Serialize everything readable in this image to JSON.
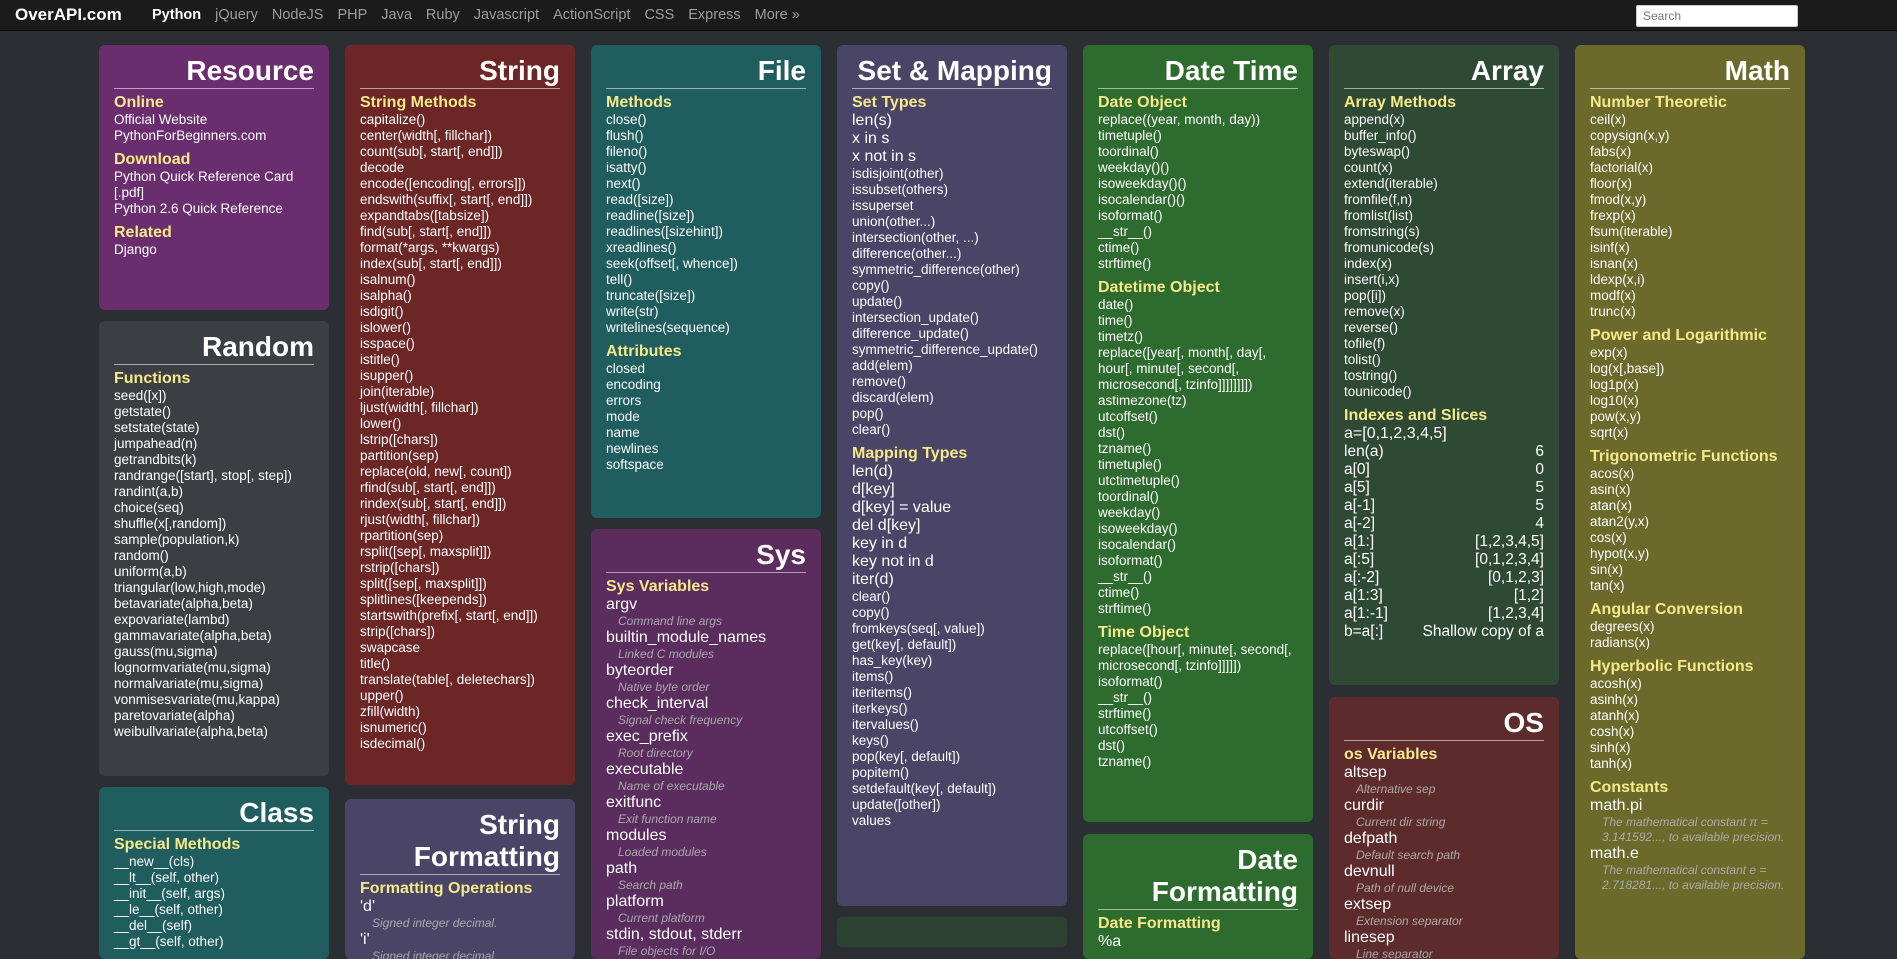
{
  "brand": "OverAPI.com",
  "nav": [
    "Python",
    "jQuery",
    "NodeJS",
    "PHP",
    "Java",
    "Ruby",
    "Javascript",
    "ActionScript",
    "CSS",
    "Express",
    "More »"
  ],
  "search": {
    "placeholder": "Search"
  },
  "cards": {
    "resource": {
      "title": "Resource",
      "sections": [
        {
          "h": "Online",
          "items": [
            "Official Website",
            "PythonForBeginners.com"
          ]
        },
        {
          "h": "Download",
          "items": [
            "Python Quick Reference Card [.pdf]",
            "Python 2.6 Quick Reference"
          ]
        },
        {
          "h": "Related",
          "items": [
            "Django"
          ]
        }
      ]
    },
    "random": {
      "title": "Random",
      "sections": [
        {
          "h": "Functions",
          "items": [
            "seed([x])",
            "getstate()",
            "setstate(state)",
            "jumpahead(n)",
            "getrandbits(k)",
            "randrange([start], stop[, step])",
            "randint(a,b)",
            "choice(seq)",
            "shuffle(x[,random])",
            "sample(population,k)",
            "random()",
            "uniform(a,b)",
            "triangular(low,high,mode)",
            "betavariate(alpha,beta)",
            "expovariate(lambd)",
            "gammavariate(alpha,beta)",
            "gauss(mu,sigma)",
            "lognormvariate(mu,sigma)",
            "normalvariate(mu,sigma)",
            "vonmisesvariate(mu,kappa)",
            "paretovariate(alpha)",
            "weibullvariate(alpha,beta)"
          ]
        }
      ]
    },
    "class": {
      "title": "Class",
      "sections": [
        {
          "h": "Special Methods",
          "items": [
            "__new__(cls)",
            "__lt__(self, other)",
            "__init__(self, args)",
            "__le__(self, other)",
            "__del__(self)",
            "__gt__(self, other)"
          ]
        }
      ]
    },
    "string": {
      "title": "String",
      "sections": [
        {
          "h": "String Methods",
          "items": [
            "capitalize()",
            "center(width[, fillchar])",
            "count(sub[, start[, end]])",
            "decode",
            "encode([encoding[, errors]])",
            "endswith(suffix[, start[, end]])",
            "expandtabs([tabsize])",
            "find(sub[, start[, end]])",
            "format(*args, **kwargs)",
            "index(sub[, start[, end]])",
            "isalnum()",
            "isalpha()",
            "isdigit()",
            "islower()",
            "isspace()",
            "istitle()",
            "isupper()",
            "join(iterable)",
            "ljust(width[, fillchar])",
            "lower()",
            "lstrip([chars])",
            "partition(sep)",
            "replace(old, new[, count])",
            "rfind(sub[, start[, end]])",
            "rindex(sub[, start[, end]])",
            "rjust(width[, fillchar])",
            "rpartition(sep)",
            "rsplit([sep[, maxsplit]])",
            "rstrip([chars])",
            "split([sep[, maxsplit]])",
            "splitlines([keepends])",
            "startswith(prefix[, start[, end]])",
            "strip([chars])",
            "swapcase",
            "title()",
            "translate(table[, deletechars])",
            "upper()",
            "zfill(width)",
            "isnumeric()",
            "isdecimal()"
          ]
        }
      ]
    },
    "stringfmt": {
      "title": "String Formatting",
      "sections": [
        {
          "h": "Formatting Operations",
          "entries": [
            {
              "k": "'d'",
              "d": "Signed integer decimal."
            },
            {
              "k": "'i'",
              "d": "Signed integer decimal."
            }
          ]
        }
      ]
    },
    "file": {
      "title": "File",
      "sections": [
        {
          "h": "Methods",
          "items": [
            "close()",
            "flush()",
            "fileno()",
            "isatty()",
            "next()",
            "read([size])",
            "readline([size])",
            "readlines([sizehint])",
            "xreadlines()",
            "seek(offset[, whence])",
            "tell()",
            "truncate([size])",
            "write(str)",
            "writelines(sequence)"
          ]
        },
        {
          "h": "Attributes",
          "items": [
            "closed",
            "encoding",
            "errors",
            "mode",
            "name",
            "newlines",
            "softspace"
          ]
        }
      ]
    },
    "sys": {
      "title": "Sys",
      "sections": [
        {
          "h": "Sys Variables",
          "entries": [
            {
              "k": "argv",
              "d": "Command line args"
            },
            {
              "k": "builtin_module_names",
              "d": "Linked C modules"
            },
            {
              "k": "byteorder",
              "d": "Native byte order"
            },
            {
              "k": "check_interval",
              "d": "Signal check frequency"
            },
            {
              "k": "exec_prefix",
              "d": "Root directory"
            },
            {
              "k": "executable",
              "d": "Name of executable"
            },
            {
              "k": "exitfunc",
              "d": "Exit function name"
            },
            {
              "k": "modules",
              "d": "Loaded modules"
            },
            {
              "k": "path",
              "d": "Search path"
            },
            {
              "k": "platform",
              "d": "Current platform"
            },
            {
              "k": "stdin, stdout, stderr",
              "d": "File objects for I/O"
            }
          ]
        }
      ]
    },
    "set": {
      "title": "Set & Mapping",
      "sections": [
        {
          "h": "Set Types",
          "big": [
            "len(s)",
            "x in s",
            "x not in s"
          ],
          "items": [
            "isdisjoint(other)",
            "issubset(others)",
            "issuperset",
            "union(other...)",
            "intersection(other, ...)",
            "difference(other...)",
            "symmetric_difference(other)",
            "copy()",
            "update()",
            "intersection_update()",
            "difference_update()",
            "symmetric_difference_update()",
            "add(elem)",
            "remove()",
            "discard(elem)",
            "pop()",
            "clear()"
          ]
        },
        {
          "h": "Mapping Types",
          "big": [
            "len(d)",
            "d[key]",
            "d[key] = value",
            "del d[key]",
            "key in d",
            "key not in d",
            "iter(d)"
          ],
          "items": [
            "clear()",
            "copy()",
            "fromkeys(seq[, value])",
            "get(key[, default])",
            "has_key(key)",
            "items()",
            "iteritems()",
            "iterkeys()",
            "itervalues()",
            "keys()",
            "pop(key[, default])",
            "popitem()",
            "setdefault(key[, default])",
            "update([other])",
            "values"
          ]
        }
      ]
    },
    "datetime": {
      "title": "Date Time",
      "sections": [
        {
          "h": "Date Object",
          "items": [
            "replace((year, month, day))",
            "timetuple()",
            "toordinal()",
            "weekday()()",
            "isoweekday()()",
            "isocalendar()()",
            "isoformat()",
            "__str__()",
            "ctime()",
            "strftime()"
          ]
        },
        {
          "h": "Datetime Object",
          "items": [
            "date()",
            "time()",
            "timetz()",
            "replace([year[, month[, day[, hour[, minute[, second[, microsecond[, tzinfo]]]]]]]])",
            "astimezone(tz)",
            "utcoffset()",
            "dst()",
            "tzname()",
            "timetuple()",
            "utctimetuple()",
            "toordinal()",
            "weekday()",
            "isoweekday()",
            "isocalendar()",
            "isoformat()",
            "__str__()",
            "ctime()",
            "strftime()"
          ]
        },
        {
          "h": "Time Object",
          "items": [
            "replace([hour[, minute[, second[, microsecond[, tzinfo]]]]])",
            "isoformat()",
            "__str__()",
            "strftime()",
            "utcoffset()",
            "dst()",
            "tzname()"
          ]
        }
      ]
    },
    "datefmt": {
      "title": "Date Formatting",
      "sections": [
        {
          "h": "Date Formatting",
          "big": [
            "%a"
          ]
        }
      ]
    },
    "array": {
      "title": "Array",
      "sections": [
        {
          "h": "Array Methods",
          "items": [
            "append(x)",
            "buffer_info()",
            "byteswap()",
            "count(x)",
            "extend(iterable)",
            "fromfile(f,n)",
            "fromlist(list)",
            "fromstring(s)",
            "fromunicode(s)",
            "index(x)",
            "insert(i,x)",
            "pop([i])",
            "remove(x)",
            "reverse()",
            "tofile(f)",
            "tolist()",
            "tostring()",
            "tounicode()"
          ]
        },
        {
          "h": "Indexes and Slices",
          "first": "a=[0,1,2,3,4,5]",
          "rows": [
            [
              "len(a)",
              "6"
            ],
            [
              "a[0]",
              "0"
            ],
            [
              "a[5]",
              "5"
            ],
            [
              "a[-1]",
              "5"
            ],
            [
              "a[-2]",
              "4"
            ],
            [
              "a[1:]",
              "[1,2,3,4,5]"
            ],
            [
              "a[:5]",
              "[0,1,2,3,4]"
            ],
            [
              "a[:-2]",
              "[0,1,2,3]"
            ],
            [
              "a[1:3]",
              "[1,2]"
            ],
            [
              "a[1:-1]",
              "[1,2,3,4]"
            ],
            [
              "b=a[:]",
              "Shallow copy of a"
            ]
          ]
        }
      ]
    },
    "os": {
      "title": "OS",
      "sections": [
        {
          "h": "os Variables",
          "entries": [
            {
              "k": "altsep",
              "d": "Alternative sep"
            },
            {
              "k": "curdir",
              "d": "Current dir string"
            },
            {
              "k": "defpath",
              "d": "Default search path"
            },
            {
              "k": "devnull",
              "d": "Path of null device"
            },
            {
              "k": "extsep",
              "d": "Extension separator"
            },
            {
              "k": "linesep",
              "d": "Line separator"
            }
          ]
        }
      ]
    },
    "math": {
      "title": "Math",
      "sections": [
        {
          "h": "Number Theoretic",
          "items": [
            "ceil(x)",
            "copysign(x,y)",
            "fabs(x)",
            "factorial(x)",
            "floor(x)",
            "fmod(x,y)",
            "frexp(x)",
            "fsum(iterable)",
            "isinf(x)",
            "isnan(x)",
            "ldexp(x,i)",
            "modf(x)",
            "trunc(x)"
          ]
        },
        {
          "h": "Power and Logarithmic",
          "items": [
            "exp(x)",
            "log(x[,base])",
            "log1p(x)",
            "log10(x)",
            "pow(x,y)",
            "sqrt(x)"
          ]
        },
        {
          "h": "Trigonometric Functions",
          "items": [
            "acos(x)",
            "asin(x)",
            "atan(x)",
            "atan2(y,x)",
            "cos(x)",
            "hypot(x,y)",
            "sin(x)",
            "tan(x)"
          ]
        },
        {
          "h": "Angular Conversion",
          "items": [
            "degrees(x)",
            "radians(x)"
          ]
        },
        {
          "h": "Hyperbolic Functions",
          "items": [
            "acosh(x)",
            "asinh(x)",
            "atanh(x)",
            "cosh(x)",
            "sinh(x)",
            "tanh(x)"
          ]
        },
        {
          "h": "Constants",
          "entries": [
            {
              "k": "math.pi",
              "d": "The mathematical constant π = 3.141592..., to available precision."
            },
            {
              "k": "math.e",
              "d": "The mathematical constant e = 2.718281..., to available precision."
            }
          ]
        }
      ]
    }
  }
}
